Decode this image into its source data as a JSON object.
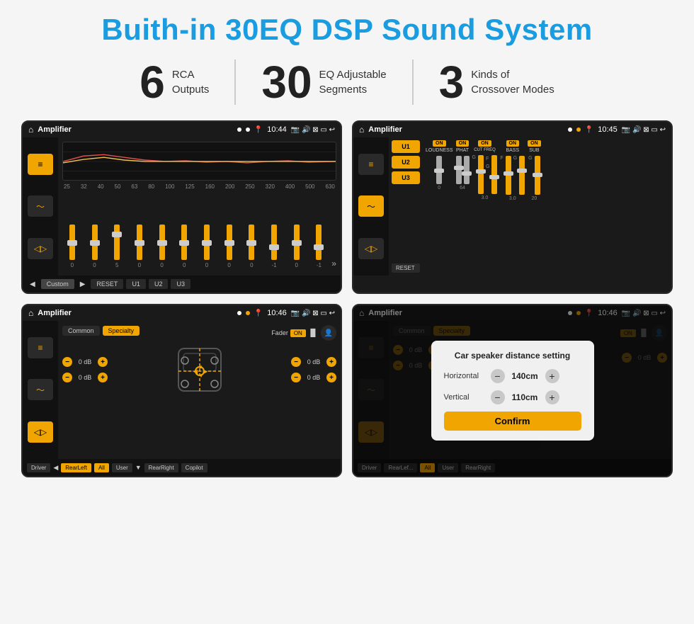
{
  "header": {
    "title": "Buith-in 30EQ DSP Sound System"
  },
  "features": [
    {
      "number": "6",
      "line1": "RCA",
      "line2": "Outputs"
    },
    {
      "number": "30",
      "line1": "EQ Adjustable",
      "line2": "Segments"
    },
    {
      "number": "3",
      "line1": "Kinds of",
      "line2": "Crossover Modes"
    }
  ],
  "screens": {
    "eq": {
      "app_title": "Amplifier",
      "time": "10:44",
      "freq_labels": [
        "25",
        "32",
        "40",
        "50",
        "63",
        "80",
        "100",
        "125",
        "160",
        "200",
        "250",
        "320",
        "400",
        "500",
        "630"
      ],
      "slider_values": [
        "0",
        "0",
        "0",
        "5",
        "0",
        "0",
        "0",
        "0",
        "0",
        "0",
        "-1",
        "0",
        "-1"
      ],
      "bottom_buttons": [
        "Custom",
        "RESET",
        "U1",
        "U2",
        "U3"
      ]
    },
    "crossover": {
      "app_title": "Amplifier",
      "time": "10:45",
      "presets": [
        "U1",
        "U2",
        "U3"
      ],
      "channels": [
        "LOUDNESS",
        "PHAT",
        "CUT FREQ",
        "BASS",
        "SUB"
      ],
      "reset_label": "RESET"
    },
    "fader": {
      "app_title": "Amplifier",
      "time": "10:46",
      "tabs": [
        "Common",
        "Specialty"
      ],
      "fader_label": "Fader",
      "on_label": "ON",
      "volume_values": [
        "0 dB",
        "0 dB",
        "0 dB",
        "0 dB"
      ],
      "bottom_buttons": [
        "Driver",
        "RearLeft",
        "All",
        "User",
        "RearRight",
        "Copilot"
      ]
    },
    "dialog": {
      "app_title": "Amplifier",
      "time": "10:46",
      "tabs": [
        "Common",
        "Specialty"
      ],
      "on_label": "ON",
      "dialog_title": "Car speaker distance setting",
      "horizontal_label": "Horizontal",
      "horizontal_value": "140cm",
      "vertical_label": "Vertical",
      "vertical_value": "110cm",
      "confirm_label": "Confirm",
      "volume_values": [
        "0 dB",
        "0 dB"
      ]
    }
  },
  "colors": {
    "accent": "#f0a500",
    "title_blue": "#1a9de0",
    "dark_bg": "#1a1a1a",
    "darker_bg": "#111111"
  }
}
